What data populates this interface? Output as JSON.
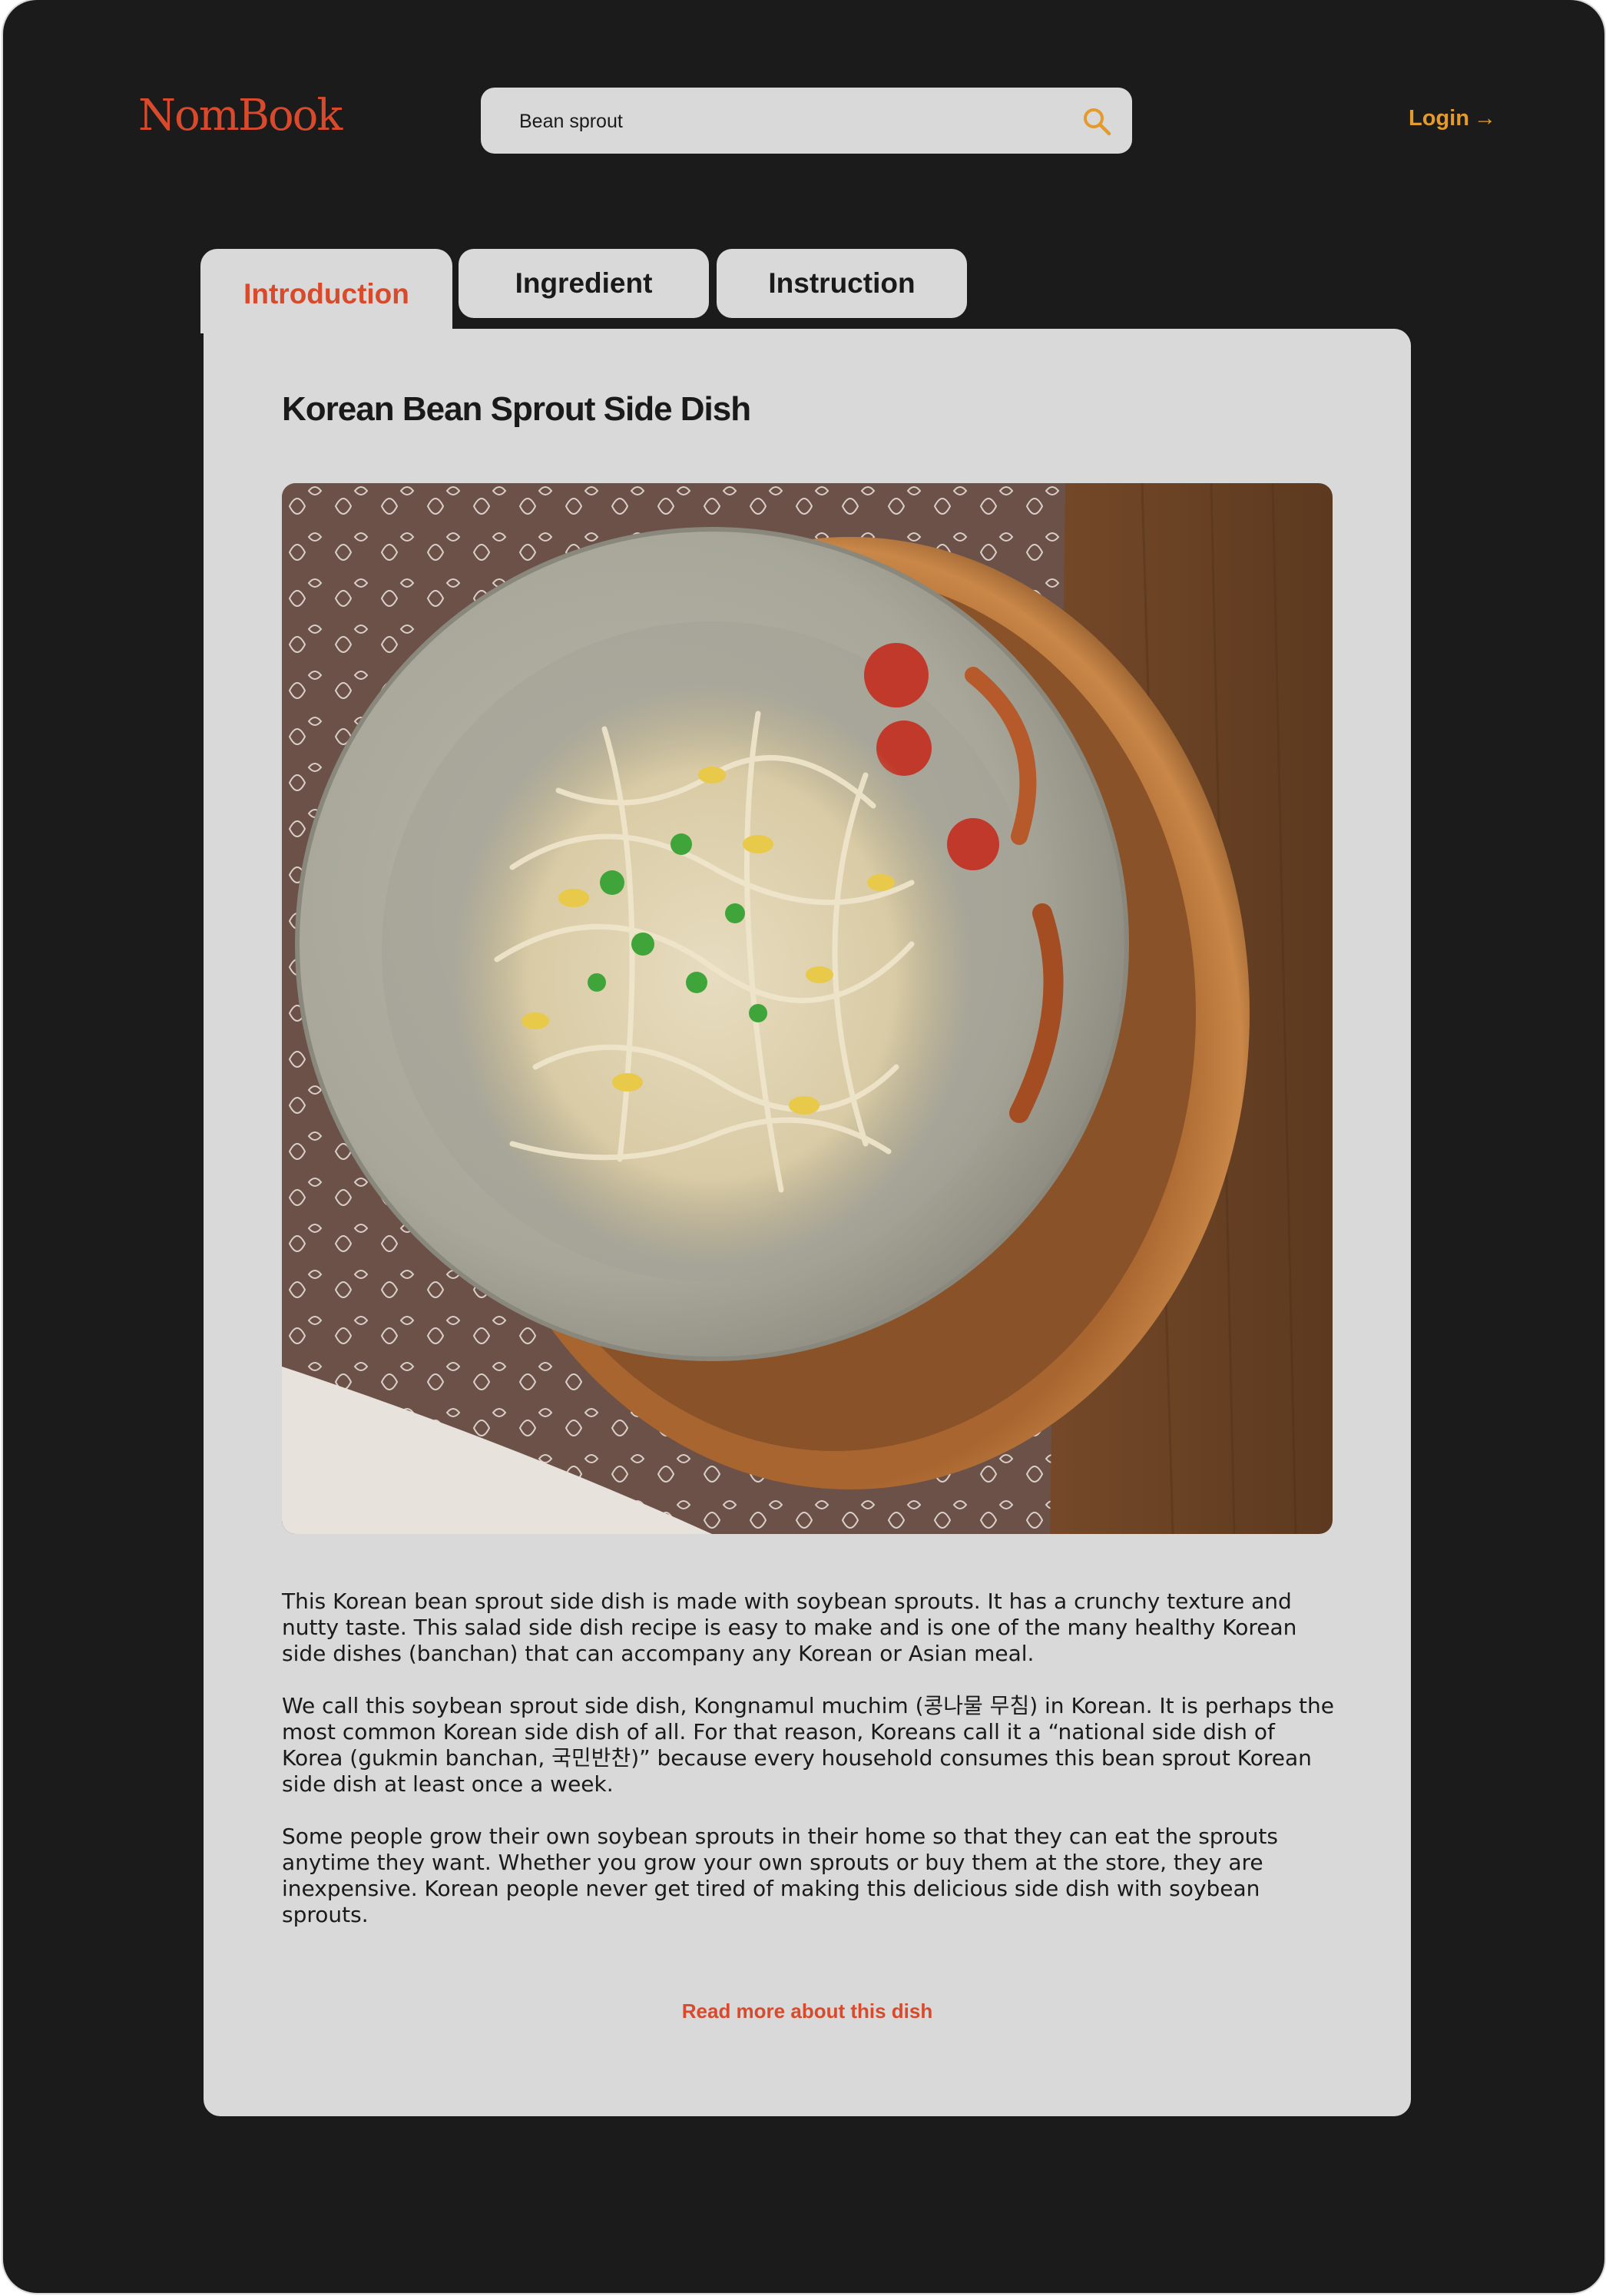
{
  "header": {
    "logo": "NomBook",
    "search": {
      "value": "Bean sprout",
      "placeholder": "Search recipes"
    },
    "login_label": "Login",
    "login_arrow": "→"
  },
  "tabs": [
    {
      "label": "Introduction",
      "active": true
    },
    {
      "label": "Ingredient",
      "active": false
    },
    {
      "label": "Instruction",
      "active": false
    }
  ],
  "content": {
    "title": "Korean Bean Sprout Side Dish",
    "image_alt": "Korean Bean Sprout Side Dish",
    "paragraphs": [
      "This Korean bean sprout side dish is made with soybean sprouts. It has a crunchy texture and nutty taste. This salad side dish recipe is easy to make and is one of the many healthy Korean side dishes (banchan) that can accompany any Korean or Asian meal.",
      "We call this soybean sprout side dish, Kongnamul muchim (콩나물 무침) in Korean. It is perhaps the most common Korean side dish of all. For that reason, Koreans call it a “national side dish of Korea (gukmin banchan, 국민반찬)” because every household consumes this bean sprout Korean side dish at least once a week.",
      "Some people grow their own soybean sprouts in their home so that they can eat the sprouts anytime they want. Whether you grow your own sprouts or buy them at the store, they are inexpensive. Korean people never get tired of making this delicious side dish with soybean sprouts."
    ],
    "read_more": "Read more about this dish"
  },
  "colors": {
    "background": "#1b1b1b",
    "card": "#d9d9d9",
    "brand": "#d84a2b",
    "accent": "#e39b2d",
    "text": "#1a1a1a"
  },
  "icons": {
    "search": "search-icon",
    "login_arrow": "arrow-right-icon"
  }
}
